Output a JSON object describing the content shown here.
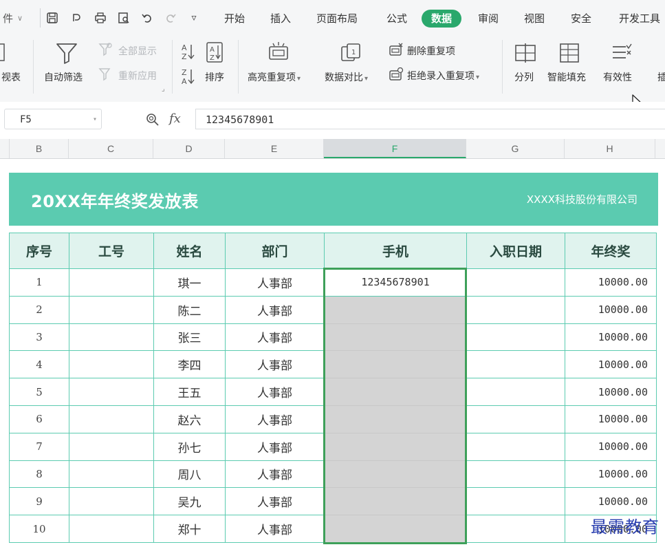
{
  "menubar": {
    "file_label": "件",
    "tabs": [
      "开始",
      "插入",
      "页面布局",
      "公式",
      "数据",
      "审阅",
      "视图",
      "安全",
      "开发工具"
    ],
    "active_tab": "数据"
  },
  "ribbon": {
    "pivot_label": "视表",
    "autofilter_label": "自动筛选",
    "show_all_label": "全部显示",
    "reapply_label": "重新应用",
    "sort_label": "排序",
    "highlight_dup_label": "高亮重复项",
    "compare_label": "数据对比",
    "remove_dup_label": "删除重复项",
    "reject_dup_label": "拒绝录入重复项",
    "split_label": "分列",
    "smart_fill_label": "智能填充",
    "validity_label": "有效性",
    "cut_label": "插"
  },
  "formula_bar": {
    "cell_ref": "F5",
    "value": "12345678901"
  },
  "columns": [
    "B",
    "C",
    "D",
    "E",
    "F",
    "G",
    "H"
  ],
  "selected_column": "F",
  "sheet": {
    "title": "20XX年年终奖发放表",
    "company": "XXXX科技股份有限公司",
    "headers": [
      "序号",
      "工号",
      "姓名",
      "部门",
      "手机",
      "入职日期",
      "年终奖"
    ],
    "rows": [
      {
        "no": "1",
        "id": "",
        "name": "琪一",
        "dept": "人事部",
        "phone": "12345678901",
        "date": "",
        "bonus": "10000.00"
      },
      {
        "no": "2",
        "id": "",
        "name": "陈二",
        "dept": "人事部",
        "phone": "",
        "date": "",
        "bonus": "10000.00"
      },
      {
        "no": "3",
        "id": "",
        "name": "张三",
        "dept": "人事部",
        "phone": "",
        "date": "",
        "bonus": "10000.00"
      },
      {
        "no": "4",
        "id": "",
        "name": "李四",
        "dept": "人事部",
        "phone": "",
        "date": "",
        "bonus": "10000.00"
      },
      {
        "no": "5",
        "id": "",
        "name": "王五",
        "dept": "人事部",
        "phone": "",
        "date": "",
        "bonus": "10000.00"
      },
      {
        "no": "6",
        "id": "",
        "name": "赵六",
        "dept": "人事部",
        "phone": "",
        "date": "",
        "bonus": "10000.00"
      },
      {
        "no": "7",
        "id": "",
        "name": "孙七",
        "dept": "人事部",
        "phone": "",
        "date": "",
        "bonus": "10000.00"
      },
      {
        "no": "8",
        "id": "",
        "name": "周八",
        "dept": "人事部",
        "phone": "",
        "date": "",
        "bonus": "10000.00"
      },
      {
        "no": "9",
        "id": "",
        "name": "吴九",
        "dept": "人事部",
        "phone": "",
        "date": "",
        "bonus": "10000.00"
      },
      {
        "no": "10",
        "id": "",
        "name": "郑十",
        "dept": "人事部",
        "phone": "",
        "date": "",
        "bonus": "10000.00"
      }
    ]
  },
  "watermark": "最需教育",
  "colors": {
    "accent": "#2aa86c",
    "banner": "#5bcbb0",
    "header_fill": "#e0f3ee",
    "selection_border": "#3ea05a"
  }
}
